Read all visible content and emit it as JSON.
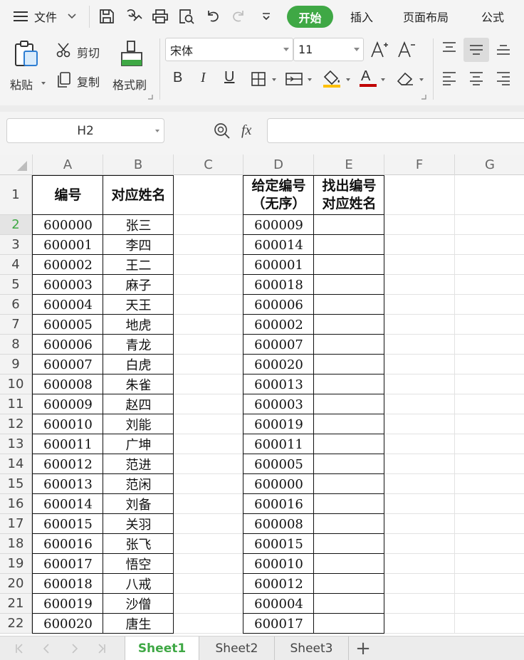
{
  "menu": {
    "file_label": "文件",
    "tabs": [
      "开始",
      "插入",
      "页面布局",
      "公式"
    ],
    "icons": [
      "menu-icon",
      "chevron-down-icon",
      "save-icon",
      "export-icon",
      "print-icon",
      "print-preview-icon",
      "undo-icon",
      "redo-icon",
      "customize-icon"
    ]
  },
  "ribbon": {
    "paste_label": "粘贴",
    "cut_label": "剪切",
    "copy_label": "复制",
    "format_painter_label": "格式刷",
    "font_name": "宋体",
    "font_size": "11",
    "bold": "B",
    "italic": "I",
    "underline": "U",
    "font_color_glyph": "A",
    "font_color": "#c00000",
    "fill_color": "#ffc000"
  },
  "formula_bar": {
    "cell_ref": "H2",
    "fx_label": "fx",
    "value": ""
  },
  "sheet": {
    "columns": [
      "A",
      "B",
      "C",
      "D",
      "E",
      "F",
      "G"
    ],
    "rows": [
      "1",
      "2",
      "3",
      "4",
      "5",
      "6",
      "7",
      "8",
      "9",
      "10",
      "11",
      "12",
      "13",
      "14",
      "15",
      "16",
      "17",
      "18",
      "19",
      "20",
      "21",
      "22"
    ],
    "active_row": "2",
    "header": {
      "a": "编号",
      "b": "对应姓名",
      "d_line1": "给定编号",
      "d_line2": "（无序）",
      "e_line1": "找出编号",
      "e_line2": "对应姓名"
    },
    "col_a": [
      "600000",
      "600001",
      "600002",
      "600003",
      "600004",
      "600005",
      "600006",
      "600007",
      "600008",
      "600009",
      "600010",
      "600011",
      "600012",
      "600013",
      "600014",
      "600015",
      "600016",
      "600017",
      "600018",
      "600019",
      "600020"
    ],
    "col_b": [
      "张三",
      "李四",
      "王二",
      "麻子",
      "天王",
      "地虎",
      "青龙",
      "白虎",
      "朱雀",
      "赵四",
      "刘能",
      "广坤",
      "范进",
      "范闲",
      "刘备",
      "关羽",
      "张飞",
      "悟空",
      "八戒",
      "沙僧",
      "唐生"
    ],
    "col_d": [
      "600009",
      "600014",
      "600001",
      "600018",
      "600006",
      "600002",
      "600007",
      "600020",
      "600013",
      "600003",
      "600019",
      "600011",
      "600005",
      "600000",
      "600016",
      "600008",
      "600015",
      "600010",
      "600012",
      "600004",
      "600017"
    ]
  },
  "sheet_tabs": {
    "tabs": [
      "Sheet1",
      "Sheet2",
      "Sheet3"
    ],
    "active": "Sheet1",
    "add_label": "+"
  },
  "accent_color": "#3fa845"
}
